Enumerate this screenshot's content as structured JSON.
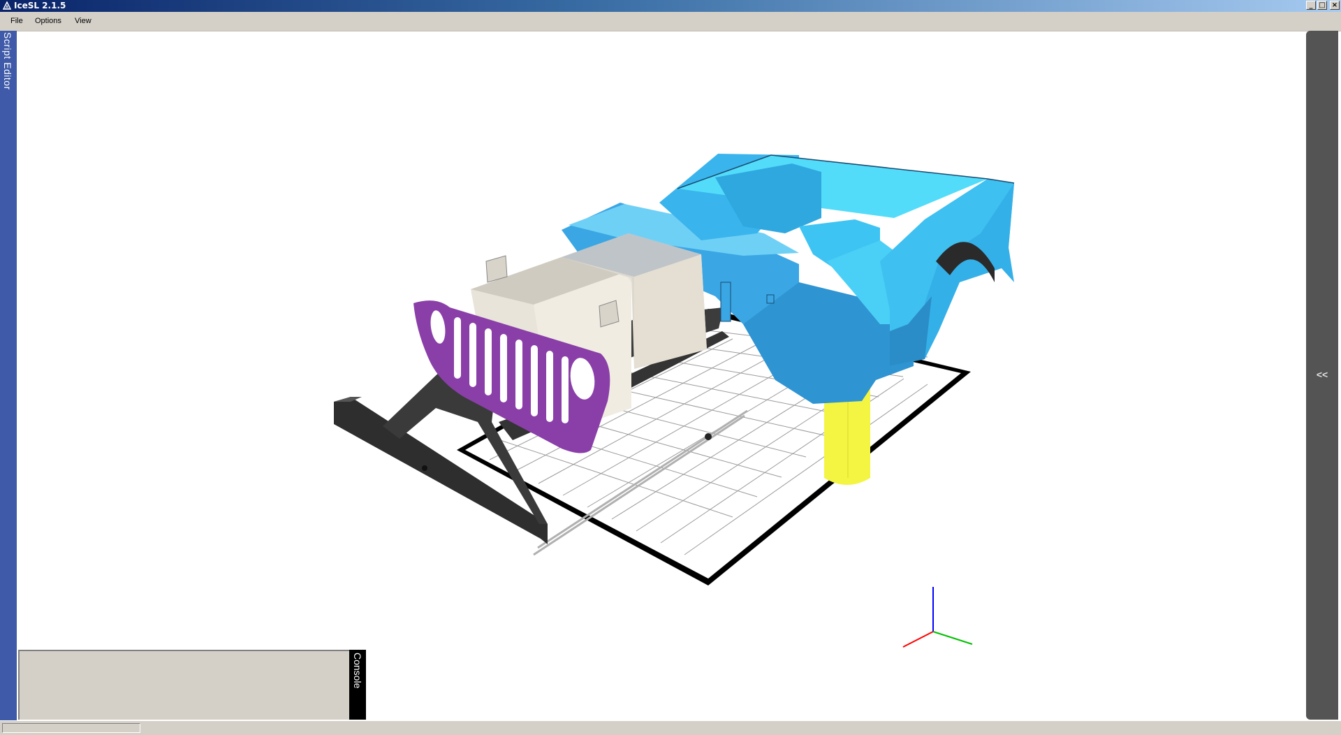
{
  "window": {
    "title": "IceSL 2.1.5"
  },
  "menu": {
    "items": [
      "File",
      "Options",
      "View"
    ]
  },
  "panels": {
    "script_editor_label": "Script Editor",
    "console_label": "Console",
    "collapse_label": "<<"
  },
  "colors": {
    "title_gradient_start": "#0a246a",
    "viewport_background": "#ffffff",
    "body_part": "#4cc8f4",
    "grille": "#8a3fa8",
    "frame": "#3a3a3a",
    "engine": "#e6e2d8",
    "support": "#f4f442",
    "side_panel": "#545454",
    "script_tab": "#3e5aa8"
  }
}
